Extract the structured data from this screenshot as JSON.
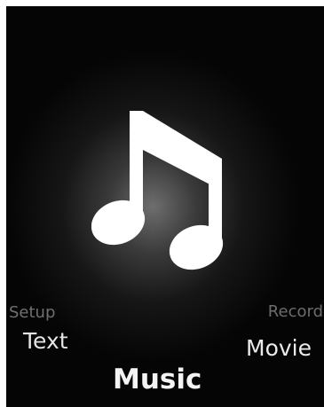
{
  "screen": {
    "active_icon": "music-note-icon"
  },
  "menu": {
    "setup_label": "Setup",
    "record_label": "Record",
    "text_label": "Text",
    "movie_label": "Movie",
    "music_label": "Music"
  },
  "colors": {
    "background": "#000000",
    "selected_text": "#ffffff",
    "near_text": "#e6e6e6",
    "far_text": "#6e6e6e",
    "icon": "#ffffff"
  }
}
